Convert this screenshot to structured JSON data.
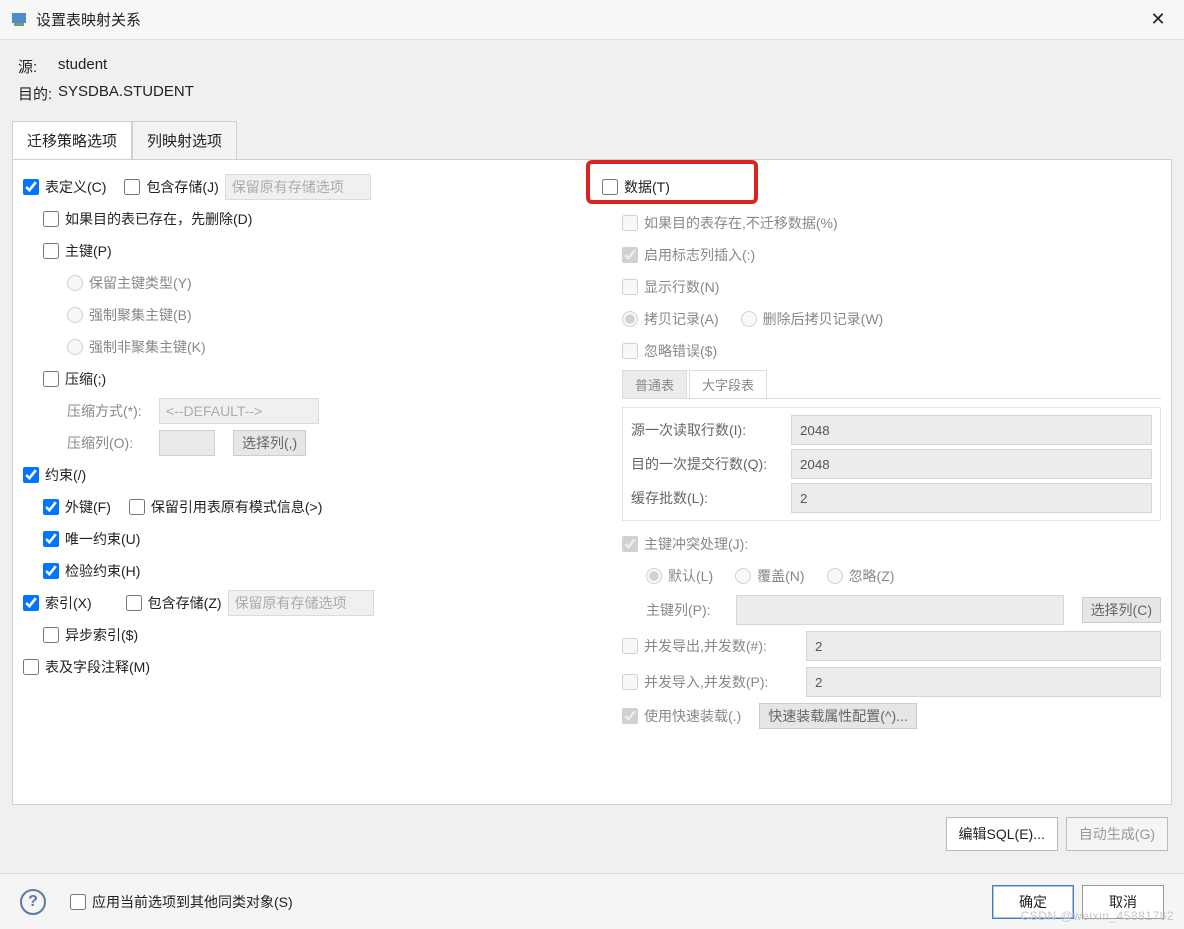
{
  "window": {
    "title": "设置表映射关系"
  },
  "meta": {
    "source_label": "源:",
    "source_value": "student",
    "target_label": "目的:",
    "target_value": "SYSDBA.STUDENT"
  },
  "tabs": {
    "migration": "迁移策略选项",
    "column_map": "列映射选项"
  },
  "left": {
    "table_def": "表定义(C)",
    "include_storage1": "包含存储(J)",
    "keep_storage_options": "保留原有存储选项",
    "if_exists_delete": "如果目的表已存在，先删除(D)",
    "pk": "主键(P)",
    "keep_pk_type": "保留主键类型(Y)",
    "force_cluster_pk": "强制聚集主键(B)",
    "force_noncluster_pk": "强制非聚集主键(K)",
    "compress": "压缩(;)",
    "compress_mode_label": "压缩方式(*):",
    "compress_mode_value": "<--DEFAULT-->",
    "compress_col_label": "压缩列(O):",
    "select_cols_btn": "选择列(,)",
    "constraint": "约束(/)",
    "fk": "外键(F)",
    "keep_ref_schema": "保留引用表原有模式信息(>)",
    "unique": "唯一约束(U)",
    "check": "检验约束(H)",
    "index": "索引(X)",
    "include_storage2": "包含存储(Z)",
    "keep_storage_options2": "保留原有存储选项",
    "async_index": "异步索引($)",
    "table_field_comment": "表及字段注释(M)"
  },
  "right": {
    "data": "数据(T)",
    "if_exists_nomigrate": "如果目的表存在,不迁移数据(%)",
    "enable_identity_insert": "启用标志列插入(:)",
    "show_rows": "显示行数(N)",
    "copy_record": "拷贝记录(A)",
    "delete_then_copy": "删除后拷贝记录(W)",
    "ignore_err": "忽略错误($)",
    "subtabs": {
      "normal": "普通表",
      "lob": "大字段表"
    },
    "src_read_rows_label": "源一次读取行数(I):",
    "src_read_rows_value": "2048",
    "dst_commit_rows_label": "目的一次提交行数(Q):",
    "dst_commit_rows_value": "2048",
    "cache_batches_label": "缓存批数(L):",
    "cache_batches_value": "2",
    "pk_conflict": "主键冲突处理(J):",
    "pk_default": "默认(L)",
    "pk_override": "覆盖(N)",
    "pk_ignore": "忽略(Z)",
    "pk_col_label": "主键列(P):",
    "select_cols_c": "选择列(C)",
    "parallel_export_label": "并发导出,并发数(#):",
    "parallel_export_value": "2",
    "parallel_import_label": "并发导入,并发数(P):",
    "parallel_import_value": "2",
    "fast_load": "使用快速装载(.)",
    "fast_load_cfg": "快速装载属性配置(^)..."
  },
  "footer": {
    "edit_sql": "编辑SQL(E)...",
    "auto_gen": "自动生成(G)"
  },
  "bottom": {
    "apply_all": "应用当前选项到其他同类对象(S)",
    "ok": "确定",
    "cancel": "取消"
  },
  "watermark": "CSDN @weixin_45881782"
}
